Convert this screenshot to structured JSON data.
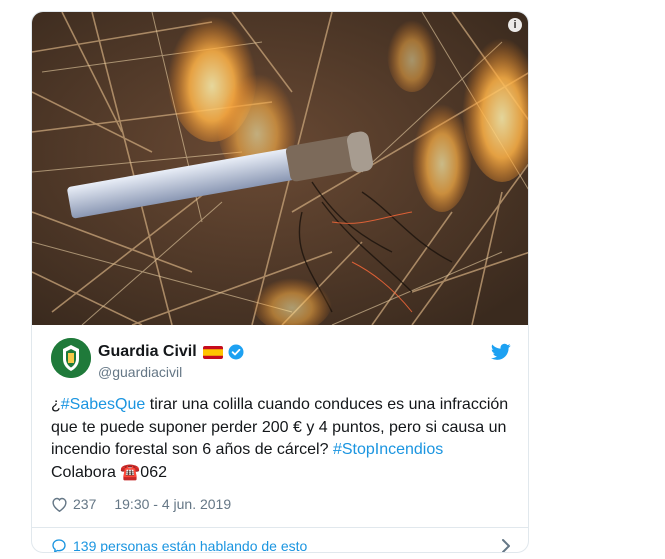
{
  "tweet": {
    "info_icon": "info-icon",
    "author": {
      "name": "Guardia Civil",
      "handle": "@guardiacivil",
      "flag": "spain-flag-icon",
      "verified": "verified-badge-icon"
    },
    "text": {
      "prefix": "¿",
      "hashtag1": "#SabesQue",
      "body": " tirar una colilla cuando conduces es una infracción que te puede suponer perder 200 € y 4 puntos, pero si causa un incendio forestal son 6 años de cárcel? ",
      "hashtag2": "#StopIncendios",
      "line2_prefix": "Colabora ",
      "phone_emoji": "☎️",
      "line2_suffix": "062"
    },
    "likes": "237",
    "timestamp": "19:30 - 4 jun. 2019",
    "footer": "139 personas están hablando de esto"
  },
  "colors": {
    "link": "#1b95e0",
    "muted": "#657786",
    "twitter_blue": "#1da1f2"
  }
}
